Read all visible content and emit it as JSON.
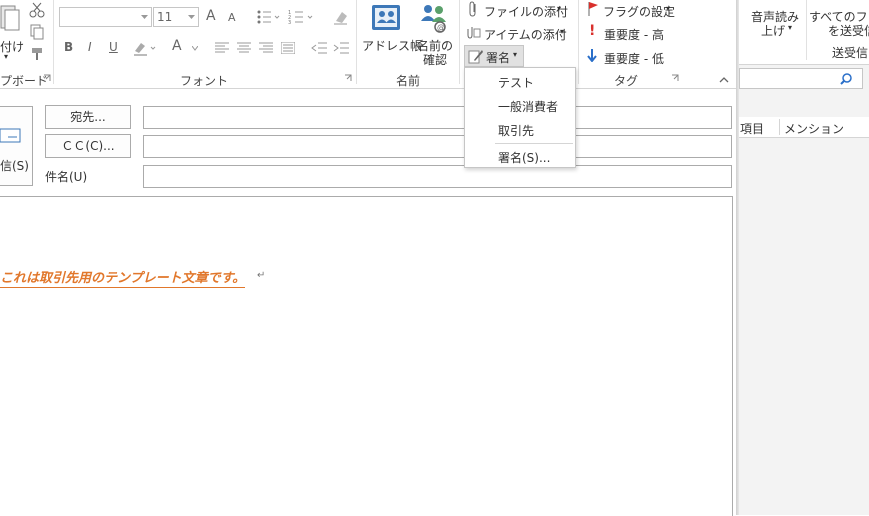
{
  "clipboard": {
    "paste_label": "付け",
    "group_label": "プボード"
  },
  "font": {
    "font_size": "11",
    "group_label": "フォント",
    "bold": "B",
    "italic": "I",
    "underline": "U",
    "grow": "A",
    "shrink": "A",
    "color": "A"
  },
  "names": {
    "address_book": "アドレス帳",
    "check_names_1": "名前の",
    "check_names_2": "確認",
    "group_label": "名前"
  },
  "include": {
    "attach_file": "ファイルの添付",
    "attach_item": "アイテムの添付",
    "signature": "署名"
  },
  "tags": {
    "follow_up": "フラグの設定",
    "high_importance": "重要度 - 高",
    "low_importance": "重要度 - 低",
    "group_label": "タグ"
  },
  "signature_menu": {
    "items": [
      "テスト",
      "一般消費者",
      "取引先"
    ],
    "signatures": "署名(S)..."
  },
  "compose": {
    "send_label": "信(S)",
    "to_button": "宛先...",
    "cc_button": "ＣＣ(C)...",
    "subject_label": "件名(U)",
    "to_value": "",
    "cc_value": "",
    "subject_value": ""
  },
  "body": {
    "text": "これは取引先用のテンプレート文章です。",
    "return_mark": "↵"
  },
  "right_pane": {
    "read_aloud_1": "音声読み",
    "read_aloud_2": "上げ",
    "send_all_1": "すべてのフォル",
    "send_all_2": "を送受信",
    "send_receive": "送受信",
    "col_item": "項目",
    "col_mention": "メンション"
  },
  "colors": {
    "accent_orange": "#e1772b",
    "flag_red": "#d9302c",
    "arrow_blue": "#2a6fc9"
  }
}
